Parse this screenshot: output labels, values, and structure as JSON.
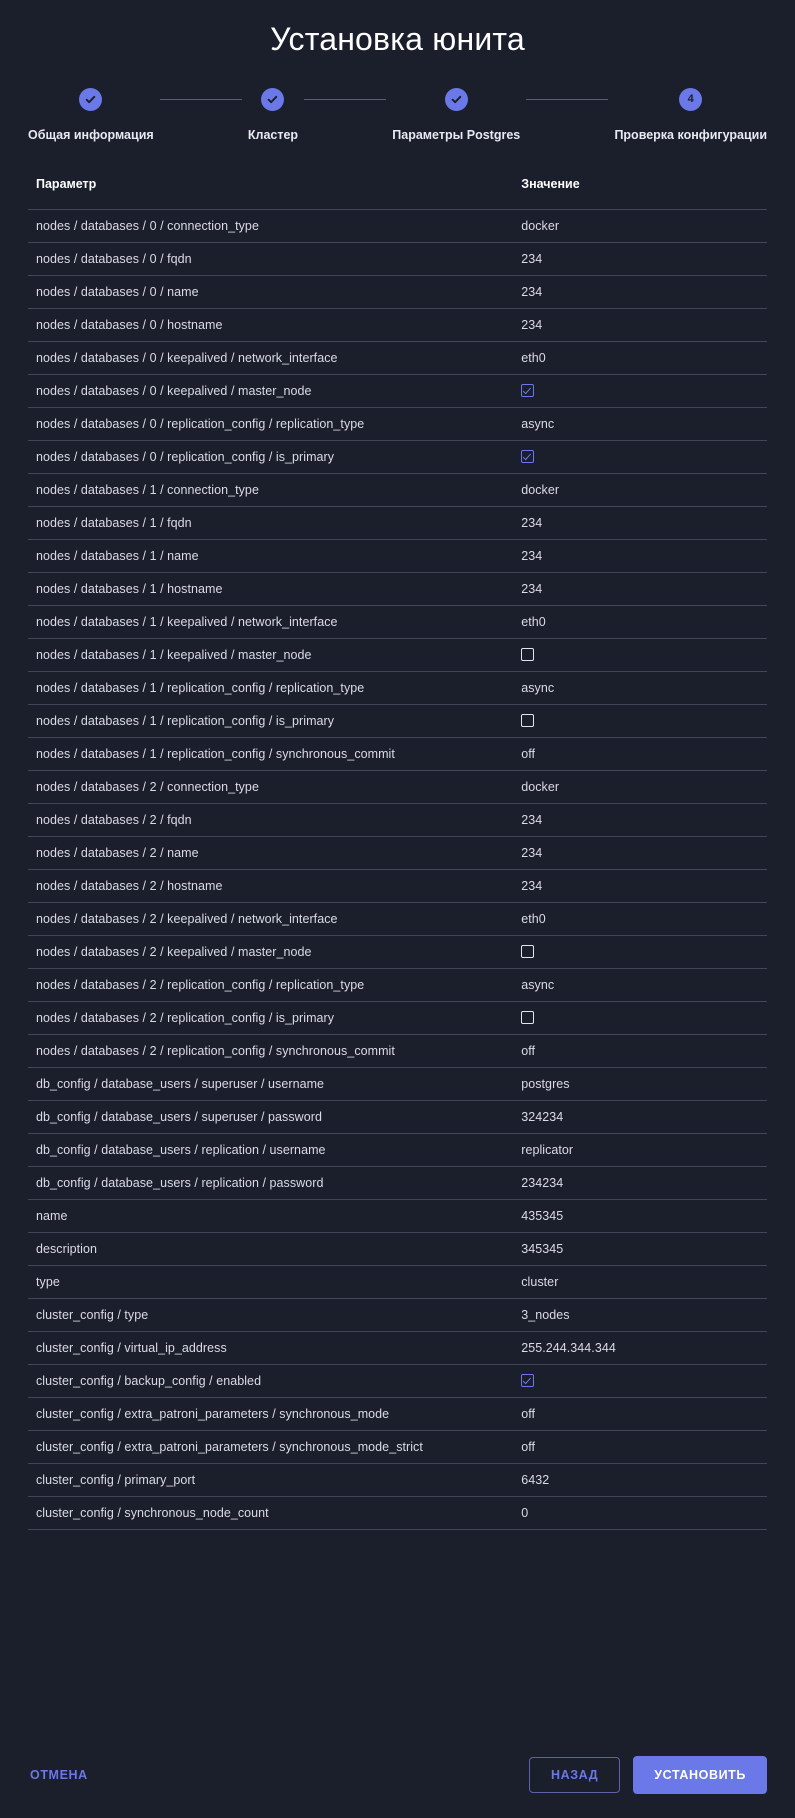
{
  "page_title": "Установка юнита",
  "colors": {
    "background": "#1B1E2B",
    "accent": "#6A78E8",
    "divider": "#41465A",
    "text": "#D9DCE6",
    "heading": "#FFFFFF"
  },
  "stepper": {
    "steps": [
      {
        "label": "Общая информация",
        "state": "done",
        "marker": "check-icon"
      },
      {
        "label": "Кластер",
        "state": "done",
        "marker": "check-icon"
      },
      {
        "label": "Параметры Postgres",
        "state": "done",
        "marker": "check-icon"
      },
      {
        "label": "Проверка конфигурации",
        "state": "current",
        "marker": "4"
      }
    ]
  },
  "table": {
    "headers": {
      "parameter": "Параметр",
      "value": "Значение"
    },
    "rows": [
      {
        "parameter": "nodes / databases / 0 / connection_type",
        "value": "docker",
        "type": "text"
      },
      {
        "parameter": "nodes / databases / 0 / fqdn",
        "value": "234",
        "type": "text"
      },
      {
        "parameter": "nodes / databases / 0 / name",
        "value": "234",
        "type": "text"
      },
      {
        "parameter": "nodes / databases / 0 / hostname",
        "value": "234",
        "type": "text"
      },
      {
        "parameter": "nodes / databases / 0 / keepalived / network_interface",
        "value": "eth0",
        "type": "text"
      },
      {
        "parameter": "nodes / databases / 0 / keepalived / master_node",
        "value": "true",
        "type": "checkbox"
      },
      {
        "parameter": "nodes / databases / 0 / replication_config / replication_type",
        "value": "async",
        "type": "text"
      },
      {
        "parameter": "nodes / databases / 0 / replication_config / is_primary",
        "value": "true",
        "type": "checkbox"
      },
      {
        "parameter": "nodes / databases / 1 / connection_type",
        "value": "docker",
        "type": "text"
      },
      {
        "parameter": "nodes / databases / 1 / fqdn",
        "value": "234",
        "type": "text"
      },
      {
        "parameter": "nodes / databases / 1 / name",
        "value": "234",
        "type": "text"
      },
      {
        "parameter": "nodes / databases / 1 / hostname",
        "value": "234",
        "type": "text"
      },
      {
        "parameter": "nodes / databases / 1 / keepalived / network_interface",
        "value": "eth0",
        "type": "text"
      },
      {
        "parameter": "nodes / databases / 1 / keepalived / master_node",
        "value": "false",
        "type": "checkbox"
      },
      {
        "parameter": "nodes / databases / 1 / replication_config / replication_type",
        "value": "async",
        "type": "text"
      },
      {
        "parameter": "nodes / databases / 1 / replication_config / is_primary",
        "value": "false",
        "type": "checkbox"
      },
      {
        "parameter": "nodes / databases / 1 / replication_config / synchronous_commit",
        "value": "off",
        "type": "text"
      },
      {
        "parameter": "nodes / databases / 2 / connection_type",
        "value": "docker",
        "type": "text"
      },
      {
        "parameter": "nodes / databases / 2 / fqdn",
        "value": "234",
        "type": "text"
      },
      {
        "parameter": "nodes / databases / 2 / name",
        "value": "234",
        "type": "text"
      },
      {
        "parameter": "nodes / databases / 2 / hostname",
        "value": "234",
        "type": "text"
      },
      {
        "parameter": "nodes / databases / 2 / keepalived / network_interface",
        "value": "eth0",
        "type": "text"
      },
      {
        "parameter": "nodes / databases / 2 / keepalived / master_node",
        "value": "false",
        "type": "checkbox"
      },
      {
        "parameter": "nodes / databases / 2 / replication_config / replication_type",
        "value": "async",
        "type": "text"
      },
      {
        "parameter": "nodes / databases / 2 / replication_config / is_primary",
        "value": "false",
        "type": "checkbox"
      },
      {
        "parameter": "nodes / databases / 2 / replication_config / synchronous_commit",
        "value": "off",
        "type": "text"
      },
      {
        "parameter": "db_config / database_users / superuser / username",
        "value": "postgres",
        "type": "text"
      },
      {
        "parameter": "db_config / database_users / superuser / password",
        "value": "324234",
        "type": "text"
      },
      {
        "parameter": "db_config / database_users / replication / username",
        "value": "replicator",
        "type": "text"
      },
      {
        "parameter": "db_config / database_users / replication / password",
        "value": "234234",
        "type": "text"
      },
      {
        "parameter": "name",
        "value": "435345",
        "type": "text"
      },
      {
        "parameter": "description",
        "value": "345345",
        "type": "text"
      },
      {
        "parameter": "type",
        "value": "cluster",
        "type": "text"
      },
      {
        "parameter": "cluster_config / type",
        "value": "3_nodes",
        "type": "text"
      },
      {
        "parameter": "cluster_config / virtual_ip_address",
        "value": "255.244.344.344",
        "type": "text"
      },
      {
        "parameter": "cluster_config / backup_config / enabled",
        "value": "true",
        "type": "checkbox"
      },
      {
        "parameter": "cluster_config / extra_patroni_parameters / synchronous_mode",
        "value": "off",
        "type": "text"
      },
      {
        "parameter": "cluster_config / extra_patroni_parameters / synchronous_mode_strict",
        "value": "off",
        "type": "text"
      },
      {
        "parameter": "cluster_config / primary_port",
        "value": "6432",
        "type": "text"
      },
      {
        "parameter": "cluster_config / synchronous_node_count",
        "value": "0",
        "type": "text"
      }
    ]
  },
  "footer": {
    "cancel_label": "ОТМЕНА",
    "back_label": "НАЗАД",
    "install_label": "УСТАНОВИТЬ"
  }
}
